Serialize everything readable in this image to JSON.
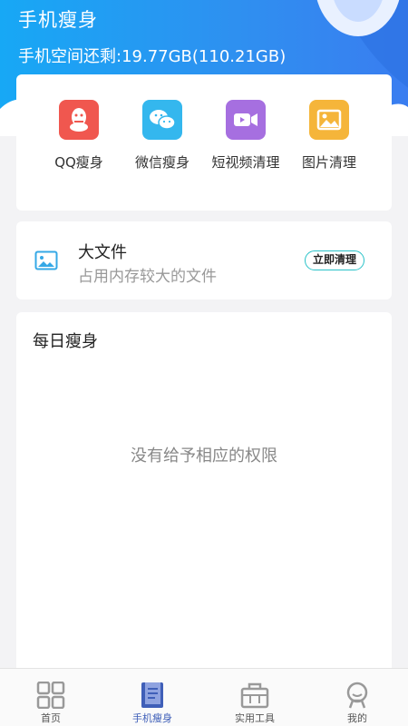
{
  "header": {
    "title": "手机瘦身",
    "storage_text": "手机空间还剩:19.77GB(110.21GB)"
  },
  "tools": [
    {
      "label": "QQ瘦身",
      "icon": "qq-icon",
      "color": "#f0574f"
    },
    {
      "label": "微信瘦身",
      "icon": "wechat-icon",
      "color": "#34b7ee"
    },
    {
      "label": "短视频清理",
      "icon": "video-icon",
      "color": "#a66fe0"
    },
    {
      "label": "图片清理",
      "icon": "image-icon",
      "color": "#f5b53a"
    }
  ],
  "large_file": {
    "title": "大文件",
    "subtitle": "占用内存较大的文件",
    "button_label": "立即清理"
  },
  "daily": {
    "title": "每日瘦身",
    "message": "没有给予相应的权限"
  },
  "tabs": [
    {
      "label": "首页",
      "icon": "grid-icon"
    },
    {
      "label": "手机瘦身",
      "icon": "book-icon",
      "active": true
    },
    {
      "label": "实用工具",
      "icon": "toolbox-icon"
    },
    {
      "label": "我的",
      "icon": "user-icon"
    }
  ],
  "colors": {
    "accent": "#2f8ff0",
    "active_tab": "#3f5fb8"
  }
}
